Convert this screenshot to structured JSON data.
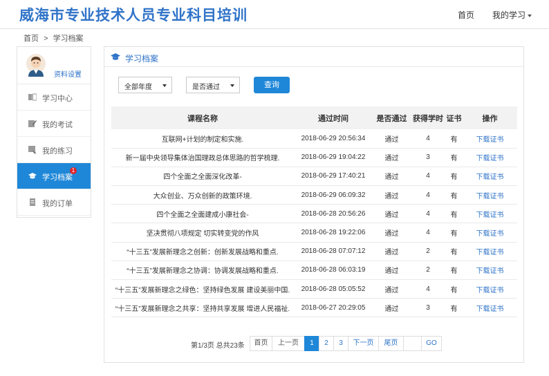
{
  "header": {
    "site_title": "威海市专业技术人员专业科目培训",
    "nav_home": "首页",
    "nav_my_learning": "我的学习"
  },
  "breadcrumb": {
    "home": "首页",
    "sep": ">",
    "current": "学习档案"
  },
  "sidebar": {
    "profile_link": "资料设置",
    "items": [
      {
        "label": "学习中心",
        "icon": "book-icon",
        "active": false
      },
      {
        "label": "我的考试",
        "icon": "exam-edit-icon",
        "active": false
      },
      {
        "label": "我的练习",
        "icon": "practice-icon",
        "active": false
      },
      {
        "label": "学习档案",
        "icon": "graduation-cap-icon",
        "active": true,
        "badge": "1"
      },
      {
        "label": "我的订单",
        "icon": "document-icon",
        "active": false
      }
    ]
  },
  "panel": {
    "title": "学习档案",
    "title_icon": "graduation-cap-icon"
  },
  "filters": {
    "year_select": "全部年度",
    "pass_select": "是否通过",
    "query_button": "查询"
  },
  "table": {
    "headers": [
      "课程名称",
      "通过时间",
      "是否通过",
      "获得学时",
      "证书",
      "操作"
    ],
    "rows": [
      {
        "name": "互联网+计划的制定和实施.",
        "time": "2018-06-29 20:56:34",
        "passed": "通过",
        "hours": "4",
        "cert": "有",
        "action": "下载证书"
      },
      {
        "name": "新一届中央领导集体治国理政总体思路的哲学梳理.",
        "time": "2018-06-29 19:04:22",
        "passed": "通过",
        "hours": "3",
        "cert": "有",
        "action": "下载证书"
      },
      {
        "name": "四个全面之全面深化改革-",
        "time": "2018-06-29 17:40:21",
        "passed": "通过",
        "hours": "4",
        "cert": "有",
        "action": "下载证书"
      },
      {
        "name": "大众创业、万众创新的政策环境.",
        "time": "2018-06-29 06:09:32",
        "passed": "通过",
        "hours": "4",
        "cert": "有",
        "action": "下载证书"
      },
      {
        "name": "四个全面之全面建成小康社会-",
        "time": "2018-06-28 20:56:26",
        "passed": "通过",
        "hours": "4",
        "cert": "有",
        "action": "下载证书"
      },
      {
        "name": "坚决贯彻八项规定 切实转变党的作风",
        "time": "2018-06-28 19:22:06",
        "passed": "通过",
        "hours": "4",
        "cert": "有",
        "action": "下载证书"
      },
      {
        "name": "“十三五”发展新理念之创新：创新发展战略和重点.",
        "time": "2018-06-28 07:07:12",
        "passed": "通过",
        "hours": "2",
        "cert": "有",
        "action": "下载证书"
      },
      {
        "name": "“十三五”发展新理念之协调：协调发展战略和重点.",
        "time": "2018-06-28 06:03:19",
        "passed": "通过",
        "hours": "2",
        "cert": "有",
        "action": "下载证书"
      },
      {
        "name": "“十三五”发展新理念之绿色：坚持绿色发展 建设美丽中国.",
        "time": "2018-06-28 05:05:52",
        "passed": "通过",
        "hours": "4",
        "cert": "有",
        "action": "下载证书"
      },
      {
        "name": "“十三五”发展新理念之共享：坚持共享发展 增进人民福祉.",
        "time": "2018-06-27 20:29:05",
        "passed": "通过",
        "hours": "3",
        "cert": "有",
        "action": "下载证书"
      }
    ]
  },
  "pagination": {
    "info": "第1/3页 总共23条",
    "first": "首页",
    "prev": "上一页",
    "pages": [
      "1",
      "2",
      "3"
    ],
    "current": "1",
    "next": "下一页",
    "last": "尾页",
    "go": "GO"
  },
  "colors": {
    "accent": "#1f87d8",
    "title_blue": "#2f73c8",
    "badge_red": "#e0232c"
  }
}
